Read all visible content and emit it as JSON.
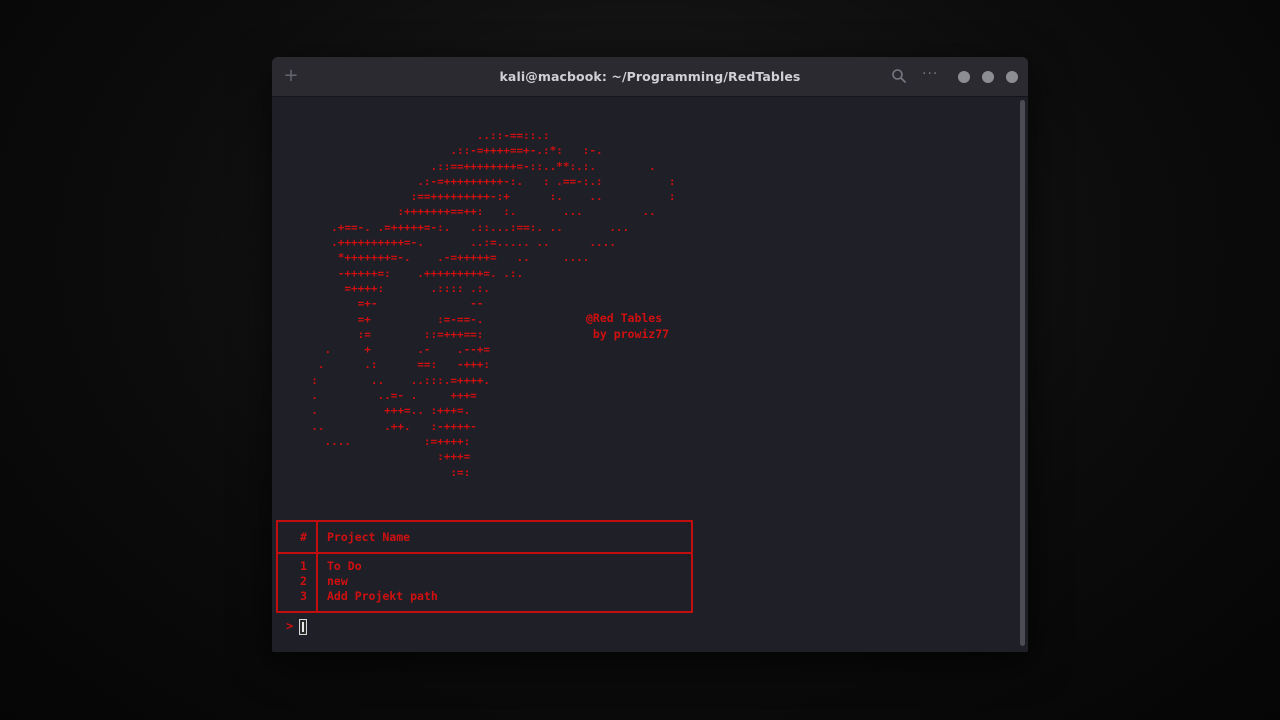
{
  "window": {
    "title": "kali@macbook: ~/Programming/RedTables",
    "new_tab_icon": "+",
    "menu_icon": "···"
  },
  "terminal": {
    "ascii_art": "                           ..::-==::.:\n                       .::-=++++==+-.:*:   :-.\n                    .::==++++++++=-::..**:.:.        .\n                  .:-=+++++++++-:.   : .==-:.:          :\n                 :==+++++++++-:+      :.    ..          :\n               :+++++++==++:   :.       ...         ..\n     .+==-. .=+++++=-:.   .::...:==:. ..       ...\n     .++++++++++=-.       ..:=..... ..      ....\n      *+++++++=-.    .-=+++++=   ..     ....\n      -+++++=:    .+++++++++=. .:.\n       =++++:       .:::: .:.\n         =+-              --\n         =+          :=-==-.\n         :=        ::=+++==:\n    .     +       .-    .--+=\n   .      .:      ==:   -+++:\n  :        ..    ..:::.=++++.\n  .         ..=- .     +++=\n  .          +++=.. :+++=.\n  ..         .++.   :-++++-\n    ....           :=++++:\n                     :+++=\n                       :=:",
    "banner": "@Red Tables\n by prowiz77",
    "table": {
      "headers": [
        "#",
        "Project Name"
      ],
      "rows": [
        {
          "num": "1",
          "name": "To Do"
        },
        {
          "num": "2",
          "name": "new"
        },
        {
          "num": "3",
          "name": "Add Projekt path"
        }
      ]
    },
    "prompt": ">"
  },
  "colors": {
    "accent": "#d01010",
    "background": "#1f1f27",
    "titlebar": "#2a2a30"
  },
  "icons": [
    "plus-icon",
    "search-icon",
    "menu-dots-icon",
    "minimize-icon",
    "maximize-icon",
    "close-icon"
  ]
}
